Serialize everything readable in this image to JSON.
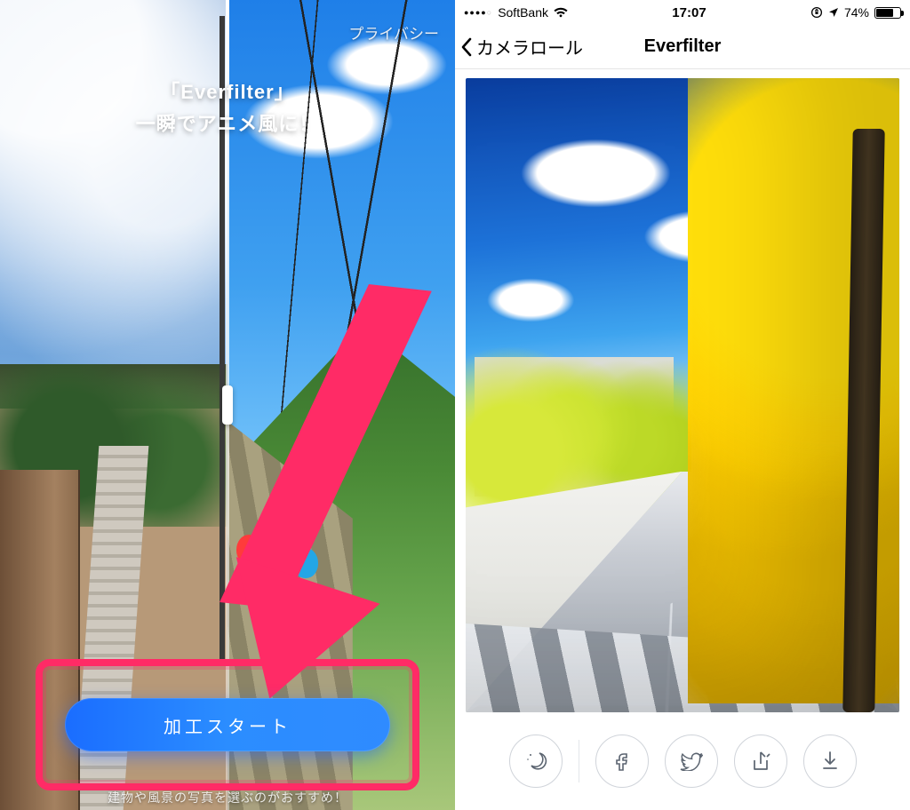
{
  "left": {
    "privacy_link": "プライバシー",
    "title_line1": "「Everfilter」",
    "title_line2": "一瞬でアニメ風に！",
    "start_button": "加工スタート",
    "subtitle": "建物や風景の写真を選ぶのがおすすめ！"
  },
  "right": {
    "statusbar": {
      "carrier": "SoftBank",
      "time": "17:07",
      "battery_percent_text": "74%",
      "battery_fill_percent": 74,
      "signal_dots_on": 4,
      "signal_dots_total": 5
    },
    "nav": {
      "back_label": "カメラロール",
      "title": "Everfilter"
    },
    "toolbar": {
      "night": "night-mode",
      "facebook": "facebook",
      "twitter": "twitter",
      "share": "share",
      "download": "download"
    }
  }
}
